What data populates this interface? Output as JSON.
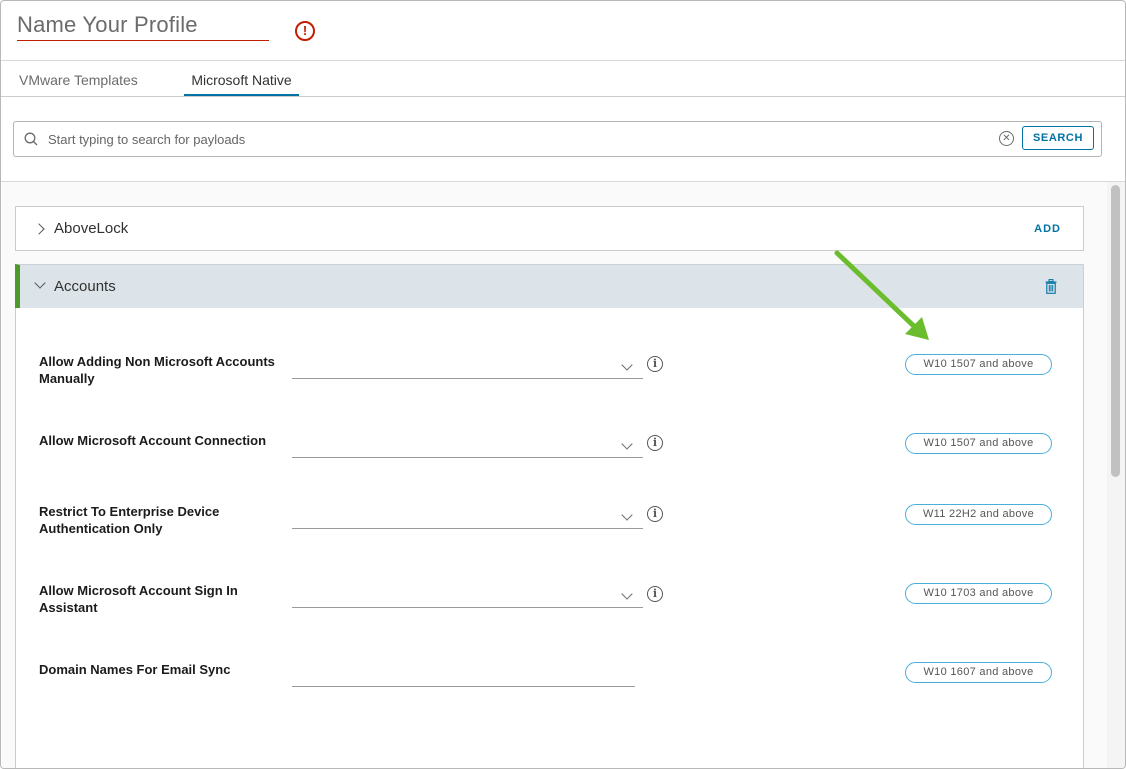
{
  "header": {
    "profile_name": "Name Your Profile",
    "error_glyph": "!"
  },
  "tabs": [
    {
      "label": "VMware Templates",
      "active": false
    },
    {
      "label": "Microsoft Native",
      "active": true
    }
  ],
  "search": {
    "placeholder": "Start typing to search for payloads",
    "value": "",
    "button_label": "SEARCH",
    "clear_glyph": "✕"
  },
  "sections": {
    "abovelock": {
      "title": "AboveLock",
      "action_label": "ADD",
      "expanded": false
    },
    "accounts": {
      "title": "Accounts",
      "expanded": true,
      "accent_color": "#4c9a2a"
    }
  },
  "rows": [
    {
      "label": "Allow Adding Non Microsoft Accounts Manually",
      "control": "select",
      "value": "",
      "info": "i",
      "badge": "W10 1507 and above"
    },
    {
      "label": "Allow Microsoft Account Connection",
      "control": "select",
      "value": "",
      "info": "i",
      "badge": "W10 1507 and above"
    },
    {
      "label": "Restrict To Enterprise Device Authentication Only",
      "control": "select",
      "value": "",
      "info": "i",
      "badge": "W11 22H2 and above"
    },
    {
      "label": "Allow Microsoft Account Sign In Assistant",
      "control": "select",
      "value": "",
      "info": "i",
      "badge": "W10 1703 and above"
    },
    {
      "label": "Domain Names For Email Sync",
      "control": "text",
      "value": "",
      "badge": "W10 1607 and above"
    }
  ],
  "colors": {
    "accent_blue": "#0072a3",
    "badge_border": "#49afd9",
    "error_red": "#c21d00",
    "arrow_green": "#6cbd2d"
  },
  "icons": [
    "error-icon",
    "search-icon",
    "clear-icon",
    "chevron-right-icon",
    "chevron-down-icon",
    "trash-icon",
    "info-icon",
    "arrow-annotation"
  ]
}
